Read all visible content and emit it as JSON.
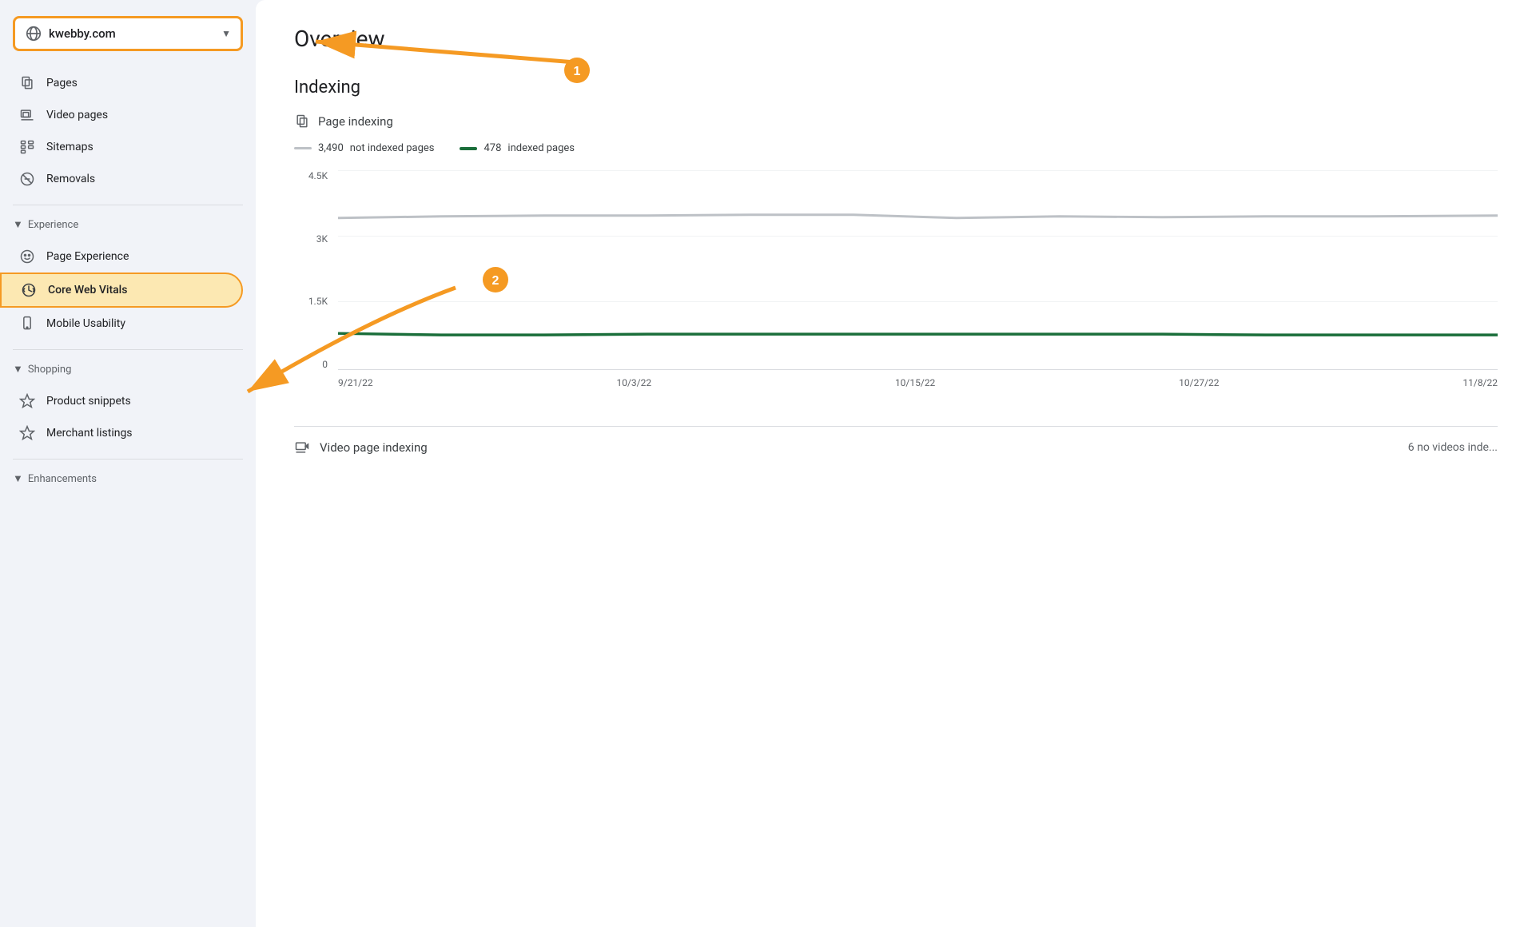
{
  "sidebar": {
    "domain": "kwebby.com",
    "domain_placeholder": "kwebby.com",
    "items_indexing": [
      {
        "label": "Pages",
        "icon": "pages-icon"
      },
      {
        "label": "Video pages",
        "icon": "video-pages-icon"
      },
      {
        "label": "Sitemaps",
        "icon": "sitemaps-icon"
      },
      {
        "label": "Removals",
        "icon": "removals-icon"
      }
    ],
    "section_experience": "Experience",
    "items_experience": [
      {
        "label": "Page Experience",
        "icon": "page-experience-icon"
      },
      {
        "label": "Core Web Vitals",
        "icon": "core-web-vitals-icon",
        "active": true
      },
      {
        "label": "Mobile Usability",
        "icon": "mobile-usability-icon"
      }
    ],
    "section_shopping": "Shopping",
    "items_shopping": [
      {
        "label": "Product snippets",
        "icon": "product-snippets-icon"
      },
      {
        "label": "Merchant listings",
        "icon": "merchant-listings-icon"
      }
    ],
    "section_enhancements": "Enhancements"
  },
  "header": {
    "title": "Overview"
  },
  "indexing": {
    "title": "Indexing",
    "page_indexing_label": "Page indexing",
    "legend": {
      "not_indexed_count": "3,490",
      "not_indexed_label": "not indexed pages",
      "indexed_count": "478",
      "indexed_label": "indexed pages"
    },
    "chart": {
      "y_labels": [
        "4.5K",
        "3K",
        "1.5K",
        "0"
      ],
      "x_labels": [
        "9/21/22",
        "10/3/22",
        "10/15/22",
        "10/27/22",
        "11/8/22"
      ]
    },
    "video_indexing_label": "Video page indexing",
    "video_indexing_status": "6 no videos inde..."
  },
  "annotations": {
    "badge1_number": "1",
    "badge2_number": "2"
  }
}
